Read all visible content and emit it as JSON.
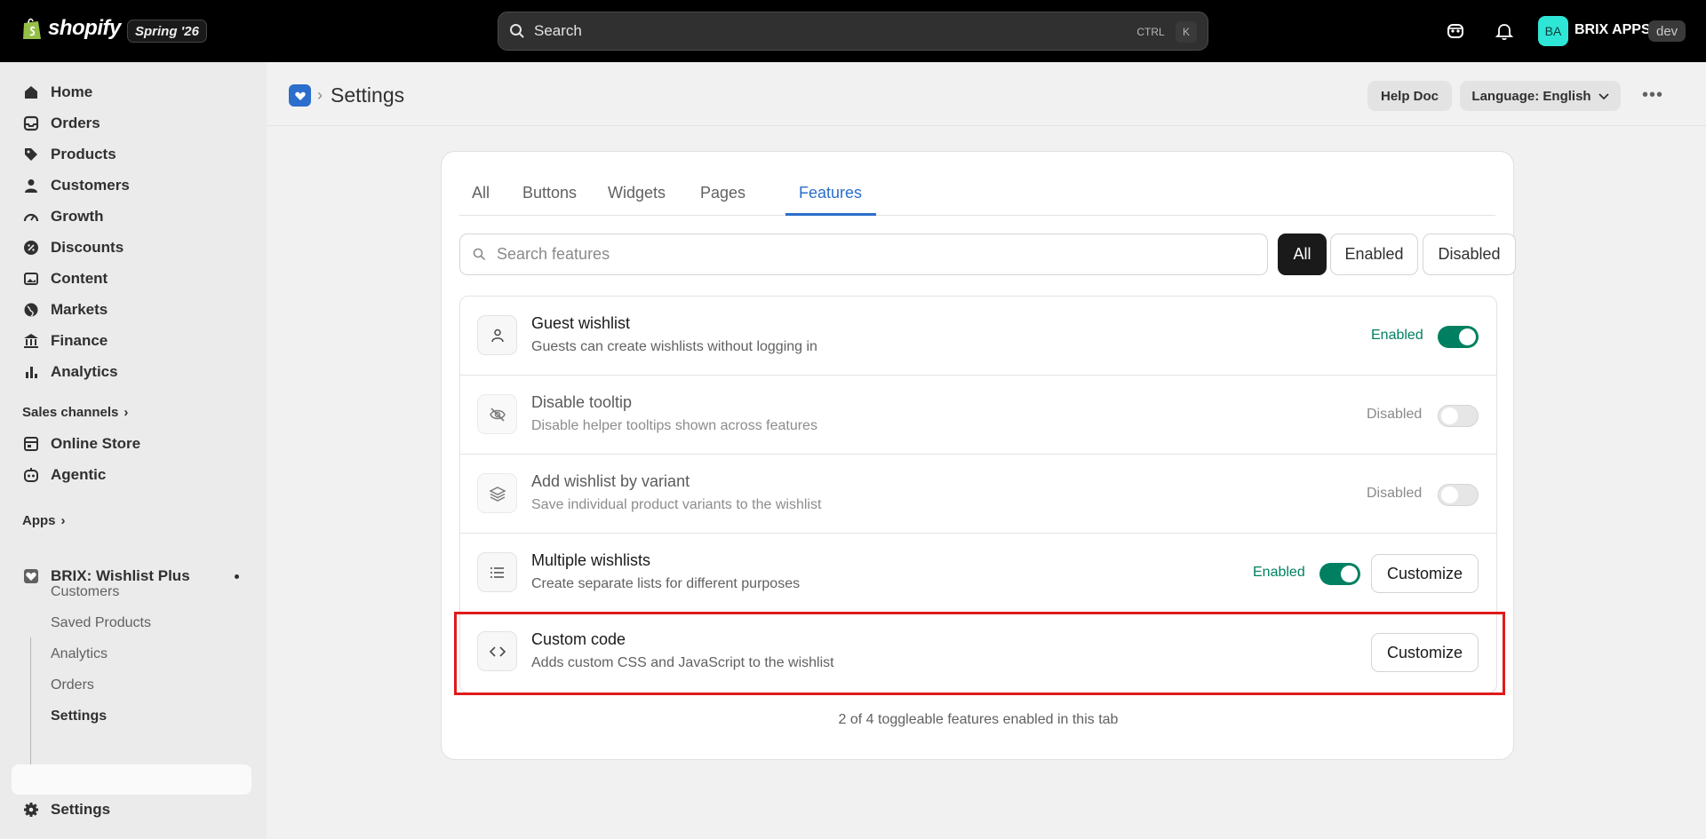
{
  "topbar": {
    "logo_text": "shopify",
    "edition": "Spring '26",
    "search_placeholder": "Search",
    "kbd_ctrl": "CTRL",
    "kbd_k": "K",
    "avatar_initials": "BA",
    "store_name": "BRIX APPS",
    "dev_badge": "dev"
  },
  "sidebar": {
    "items": [
      {
        "label": "Home",
        "icon": "home-icon"
      },
      {
        "label": "Orders",
        "icon": "inbox-icon"
      },
      {
        "label": "Products",
        "icon": "tag-icon"
      },
      {
        "label": "Customers",
        "icon": "person-icon"
      },
      {
        "label": "Growth",
        "icon": "gauge-icon"
      },
      {
        "label": "Discounts",
        "icon": "discount-icon"
      },
      {
        "label": "Content",
        "icon": "image-icon"
      },
      {
        "label": "Markets",
        "icon": "globe-icon"
      },
      {
        "label": "Finance",
        "icon": "bank-icon"
      },
      {
        "label": "Analytics",
        "icon": "bar-chart-icon"
      }
    ],
    "sales_channels_label": "Sales channels",
    "channels": [
      {
        "label": "Online Store",
        "icon": "store-icon"
      },
      {
        "label": "Agentic",
        "icon": "agent-icon"
      }
    ],
    "apps_label": "Apps",
    "app": {
      "label": "BRIX: Wishlist Plus",
      "icon": "wishlist-heart-icon"
    },
    "app_subitems": [
      "Customers",
      "Saved Products",
      "Analytics",
      "Orders",
      "Settings"
    ],
    "settings_label": "Settings"
  },
  "header": {
    "title": "Settings",
    "help_doc": "Help Doc",
    "language": "Language: English"
  },
  "tabs": [
    "All",
    "Buttons",
    "Widgets",
    "Pages",
    "Features"
  ],
  "active_tab": "Features",
  "filter": {
    "search_placeholder": "Search features",
    "buttons": [
      "All",
      "Enabled",
      "Disabled"
    ],
    "selected": "All"
  },
  "features": [
    {
      "title": "Guest wishlist",
      "desc": "Guests can create wishlists without logging in",
      "status": "Enabled",
      "enabled": true,
      "icon": "person-icon",
      "customize": ""
    },
    {
      "title": "Disable tooltip",
      "desc": "Disable helper tooltips shown across features",
      "status": "Disabled",
      "enabled": false,
      "icon": "eye-off-icon",
      "customize": ""
    },
    {
      "title": "Add wishlist by variant",
      "desc": "Save individual product variants to the wishlist",
      "status": "Disabled",
      "enabled": false,
      "icon": "layers-icon",
      "customize": ""
    },
    {
      "title": "Multiple wishlists",
      "desc": "Create separate lists for different purposes",
      "status": "Enabled",
      "enabled": true,
      "icon": "list-icon",
      "customize": "Customize"
    },
    {
      "title": "Custom code",
      "desc": "Adds custom CSS and JavaScript to the wishlist",
      "status": "",
      "enabled": null,
      "icon": "code-icon",
      "customize": "Customize"
    }
  ],
  "footer_note": "2 of 4 toggleable features enabled in this tab",
  "colors": {
    "accent": "#2c6ecb",
    "enabled": "#008060",
    "highlight": "#e01a1a"
  }
}
